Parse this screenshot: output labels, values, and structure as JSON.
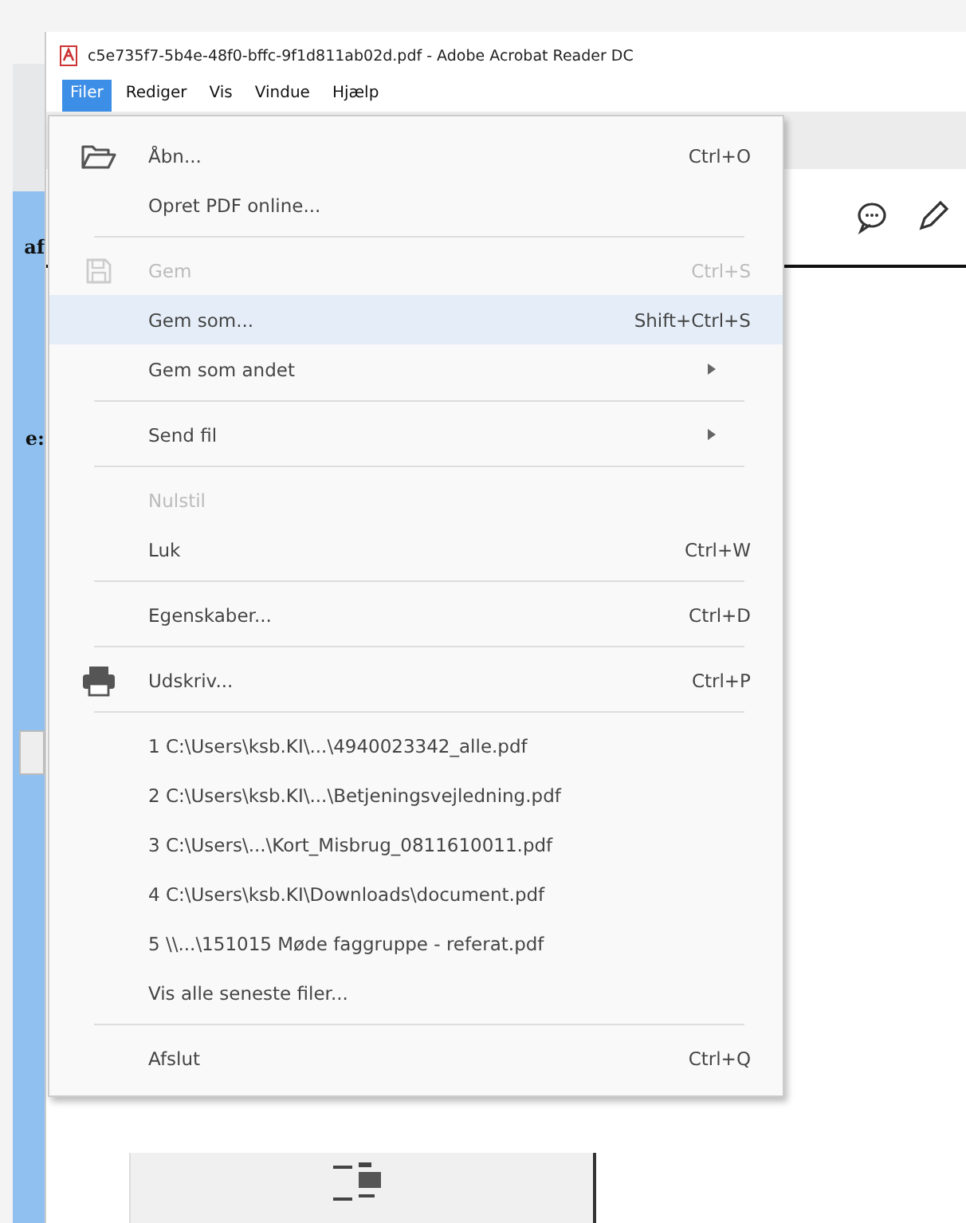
{
  "window": {
    "title": "c5e735f7-5b4e-48f0-bffc-9f1d811ab02d.pdf - Adobe Acrobat Reader DC"
  },
  "menu_bar": [
    {
      "label": "Filer",
      "selected": true
    },
    {
      "label": "Rediger",
      "selected": false
    },
    {
      "label": "Vis",
      "selected": false
    },
    {
      "label": "Vindue",
      "selected": false
    },
    {
      "label": "Hjælp",
      "selected": false
    }
  ],
  "side_fragments": [
    "af",
    "e:"
  ],
  "file_menu": [
    {
      "kind": "item",
      "label": "Åbn...",
      "shortcut": "Ctrl+O",
      "disabled": false,
      "selected": false
    },
    {
      "kind": "item",
      "label": "Opret PDF online...",
      "disabled": false,
      "selected": false
    },
    {
      "kind": "separator"
    },
    {
      "kind": "item",
      "label": "Gem",
      "shortcut": "Ctrl+S",
      "disabled": true,
      "selected": false
    },
    {
      "kind": "item",
      "label": "Gem som...",
      "shortcut": "Shift+Ctrl+S",
      "disabled": false,
      "selected": true
    },
    {
      "kind": "item",
      "label": "Gem som andet",
      "submenu": true,
      "disabled": false,
      "selected": false
    },
    {
      "kind": "separator"
    },
    {
      "kind": "item",
      "label": "Send fil",
      "submenu": true,
      "disabled": false,
      "selected": false
    },
    {
      "kind": "separator"
    },
    {
      "kind": "item",
      "label": "Nulstil",
      "disabled": true,
      "selected": false
    },
    {
      "kind": "item",
      "label": "Luk",
      "shortcut": "Ctrl+W",
      "disabled": false,
      "selected": false
    },
    {
      "kind": "separator"
    },
    {
      "kind": "item",
      "label": "Egenskaber...",
      "shortcut": "Ctrl+D",
      "disabled": false,
      "selected": false
    },
    {
      "kind": "separator"
    },
    {
      "kind": "item",
      "label": "Udskriv...",
      "shortcut": "Ctrl+P",
      "disabled": false,
      "selected": false
    },
    {
      "kind": "separator"
    },
    {
      "kind": "item",
      "label": "1 C:\\Users\\ksb.KI\\...\\4940023342_alle.pdf",
      "disabled": false,
      "selected": false
    },
    {
      "kind": "item",
      "label": "2 C:\\Users\\ksb.KI\\...\\Betjeningsvejledning.pdf",
      "disabled": false,
      "selected": false
    },
    {
      "kind": "item",
      "label": "3 C:\\Users\\...\\Kort_Misbrug_0811610011.pdf",
      "disabled": false,
      "selected": false
    },
    {
      "kind": "item",
      "label": "4 C:\\Users\\ksb.KI\\Downloads\\document.pdf",
      "disabled": false,
      "selected": false
    },
    {
      "kind": "item",
      "label": "5 \\\\...\\151015 Møde faggruppe - referat.pdf",
      "disabled": false,
      "selected": false
    },
    {
      "kind": "item",
      "label": "Vis alle seneste filer...",
      "disabled": false,
      "selected": false
    },
    {
      "kind": "separator"
    },
    {
      "kind": "item",
      "label": "Afslut",
      "shortcut": "Ctrl+Q",
      "disabled": false,
      "selected": false
    }
  ]
}
